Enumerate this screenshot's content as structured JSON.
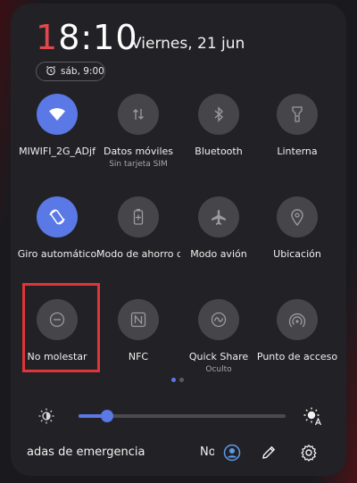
{
  "header": {
    "clock_first_digit": "1",
    "clock_rest": "8:10",
    "date": "Viernes, 21 jun",
    "alarm": "sáb, 9:00"
  },
  "tiles": [
    {
      "label": "MIWIFI_2G_ADjf",
      "sublabel": "",
      "icon": "wifi-icon",
      "active": true
    },
    {
      "label": "Datos móviles",
      "sublabel": "Sin tarjeta SIM",
      "icon": "mobile-data-icon",
      "active": false
    },
    {
      "label": "Bluetooth",
      "sublabel": "",
      "icon": "bluetooth-icon",
      "active": false
    },
    {
      "label": "Linterna",
      "sublabel": "",
      "icon": "flashlight-icon",
      "active": false
    },
    {
      "label": "Giro automático",
      "sublabel": "",
      "icon": "auto-rotate-icon",
      "active": true
    },
    {
      "label": "Modo de ahorro d",
      "sublabel": "",
      "icon": "battery-saver-icon",
      "active": false
    },
    {
      "label": "Modo avión",
      "sublabel": "",
      "icon": "airplane-icon",
      "active": false
    },
    {
      "label": "Ubicación",
      "sublabel": "",
      "icon": "location-icon",
      "active": false
    },
    {
      "label": "No molestar",
      "sublabel": "",
      "icon": "do-not-disturb-icon",
      "active": false
    },
    {
      "label": "NFC",
      "sublabel": "",
      "icon": "nfc-icon",
      "active": false
    },
    {
      "label": "Quick Share",
      "sublabel": "Oculto",
      "icon": "quick-share-icon",
      "active": false
    },
    {
      "label": "Punto de acceso",
      "sublabel": "",
      "icon": "hotspot-icon",
      "active": false
    }
  ],
  "brightness": {
    "level": 0.14
  },
  "bottom": {
    "emergency_label": "adas de emergencia",
    "partial_label": "No"
  },
  "colors": {
    "accent": "#5a78e6",
    "highlight": "#e0343a",
    "clock_accent": "#e0484f"
  }
}
